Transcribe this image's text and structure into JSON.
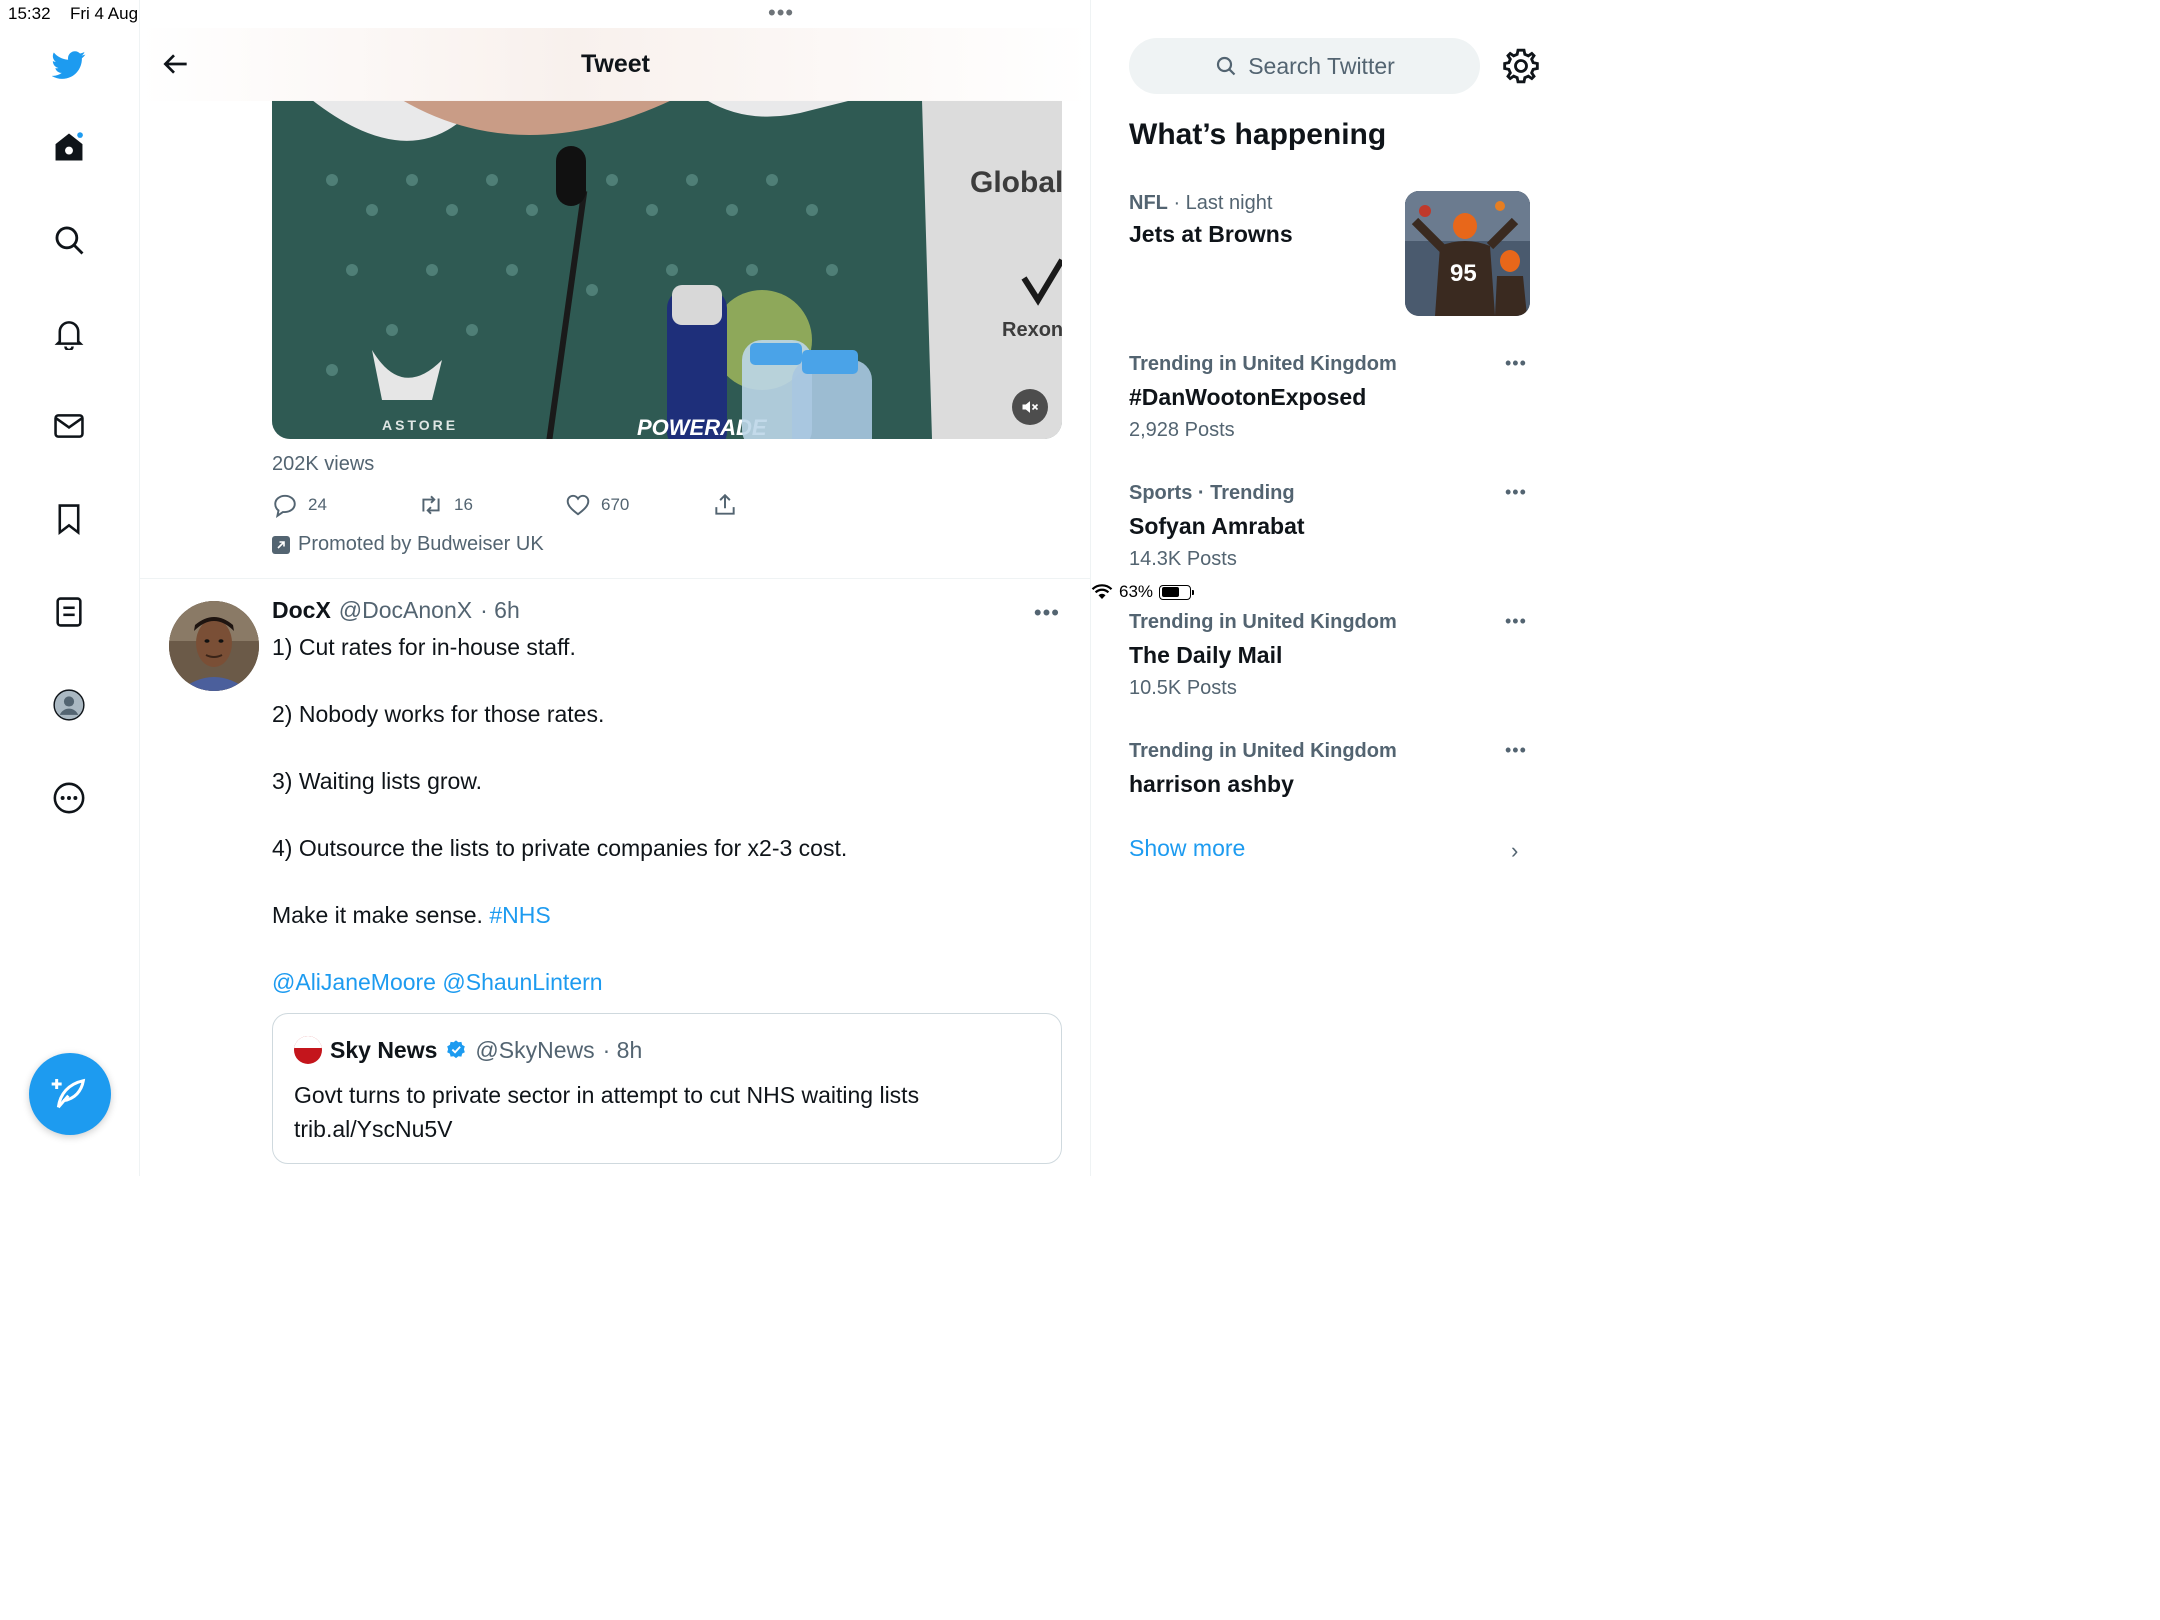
{
  "status_bar": {
    "time": "15:32",
    "date": "Fri 4 Aug",
    "battery": "63%"
  },
  "header": {
    "title": "Tweet"
  },
  "promoted_tweet": {
    "views": "202K views",
    "replies": "24",
    "retweets": "16",
    "likes": "670",
    "promoted_label": "Promoted by Budweiser UK",
    "media_text": {
      "brand1": "Global",
      "brand2": "Rexona",
      "shirt": "ASTORE",
      "bottle": "POWERADE"
    }
  },
  "tweet": {
    "name": "DocX",
    "handle": "@DocAnonX",
    "time": "· 6h",
    "lines": [
      "1) Cut rates for in-house staff.",
      "2) Nobody works for those rates.",
      "3) Waiting lists grow.",
      "4) Outsource the lists to private companies for x2-3 cost."
    ],
    "closing_text": "Make it make sense.",
    "hashtag": "#NHS",
    "mention1": "@AliJaneMoore",
    "mention2": "@ShaunLintern"
  },
  "quote": {
    "name": "Sky News",
    "handle": "@SkyNews",
    "time": "· 8h",
    "text_line1": "Govt turns to private sector in attempt to cut NHS waiting lists",
    "text_line2": "trib.al/YscNu5V"
  },
  "sidebar": {
    "search_placeholder": "Search Twitter",
    "section_title": "What’s happening",
    "trends": [
      {
        "category": "NFL",
        "context": "· Last night",
        "topic": "Jets at Browns",
        "count": ""
      },
      {
        "category": "Trending in United Kingdom",
        "context": "",
        "topic": "#DanWootonExposed",
        "count": "2,928 Posts"
      },
      {
        "category": "Sports",
        "context": "· Trending",
        "topic": "Sofyan Amrabat",
        "count": "14.3K Posts"
      },
      {
        "category": "Trending in United Kingdom",
        "context": "",
        "topic": "The Daily Mail",
        "count": "10.5K Posts"
      },
      {
        "category": "Trending in United Kingdom",
        "context": "",
        "topic": "harrison ashby",
        "count": ""
      }
    ],
    "trend_image_jersey": "95",
    "show_more": "Show more"
  },
  "colors": {
    "accent": "#1d9bf0",
    "text_primary": "#0f1419",
    "text_secondary": "#536471"
  },
  "icons": {
    "nav": [
      "twitter-logo-icon",
      "home-icon",
      "search-icon",
      "bell-icon",
      "mail-icon",
      "bookmark-icon",
      "lists-icon",
      "profile-icon",
      "more-icon",
      "compose-icon"
    ]
  }
}
